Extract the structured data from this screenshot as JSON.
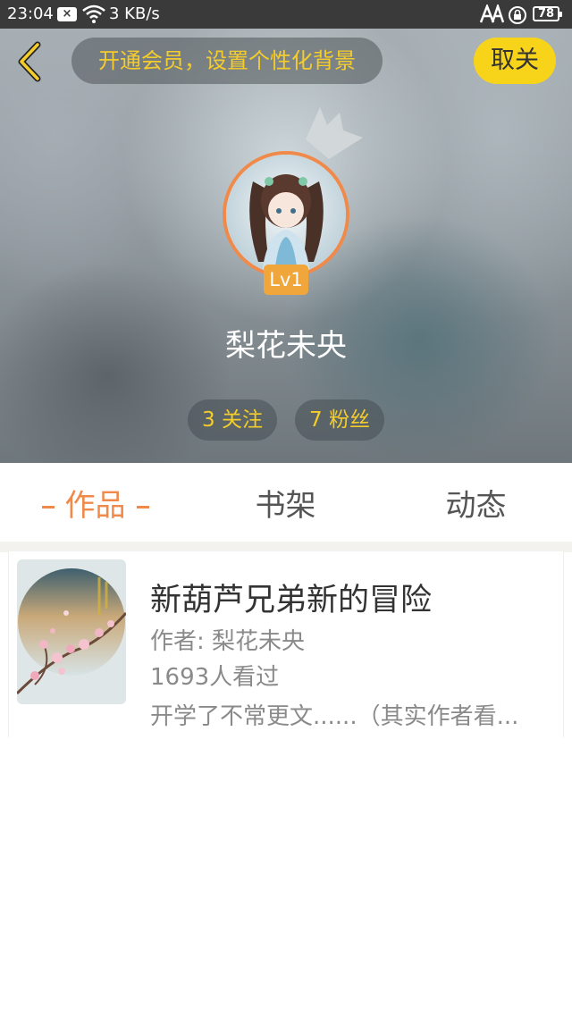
{
  "status_bar": {
    "time": "23:04",
    "network_speed": "3 KB/s",
    "battery": "78",
    "notification_icon": "close-notification-icon",
    "wifi_icon": "wifi-icon",
    "sim_icon": "sim-status-icon",
    "lock_icon": "rotation-lock-icon"
  },
  "header": {
    "back_icon": "chevron-left-icon",
    "vip_banner": "开通会员，设置个性化背景",
    "unfollow_button": "取关"
  },
  "profile": {
    "username": "梨花未央",
    "level": "Lv1",
    "following": "3 关注",
    "fans": "7 粉丝",
    "crown_icon": "crown-icon"
  },
  "tabs": {
    "items": [
      {
        "label": "作品",
        "active": true
      },
      {
        "label": "书架",
        "active": false
      },
      {
        "label": "动态",
        "active": false
      }
    ]
  },
  "works": [
    {
      "title": "新葫芦兄弟新的冒险",
      "author": "作者: 梨花未央",
      "views": "1693人看过",
      "description": "开学了不常更文......（其实作者看..."
    }
  ],
  "colors": {
    "accent_orange": "#f08a4b",
    "accent_yellow": "#f7d41a",
    "level_badge": "#f0a63a"
  }
}
